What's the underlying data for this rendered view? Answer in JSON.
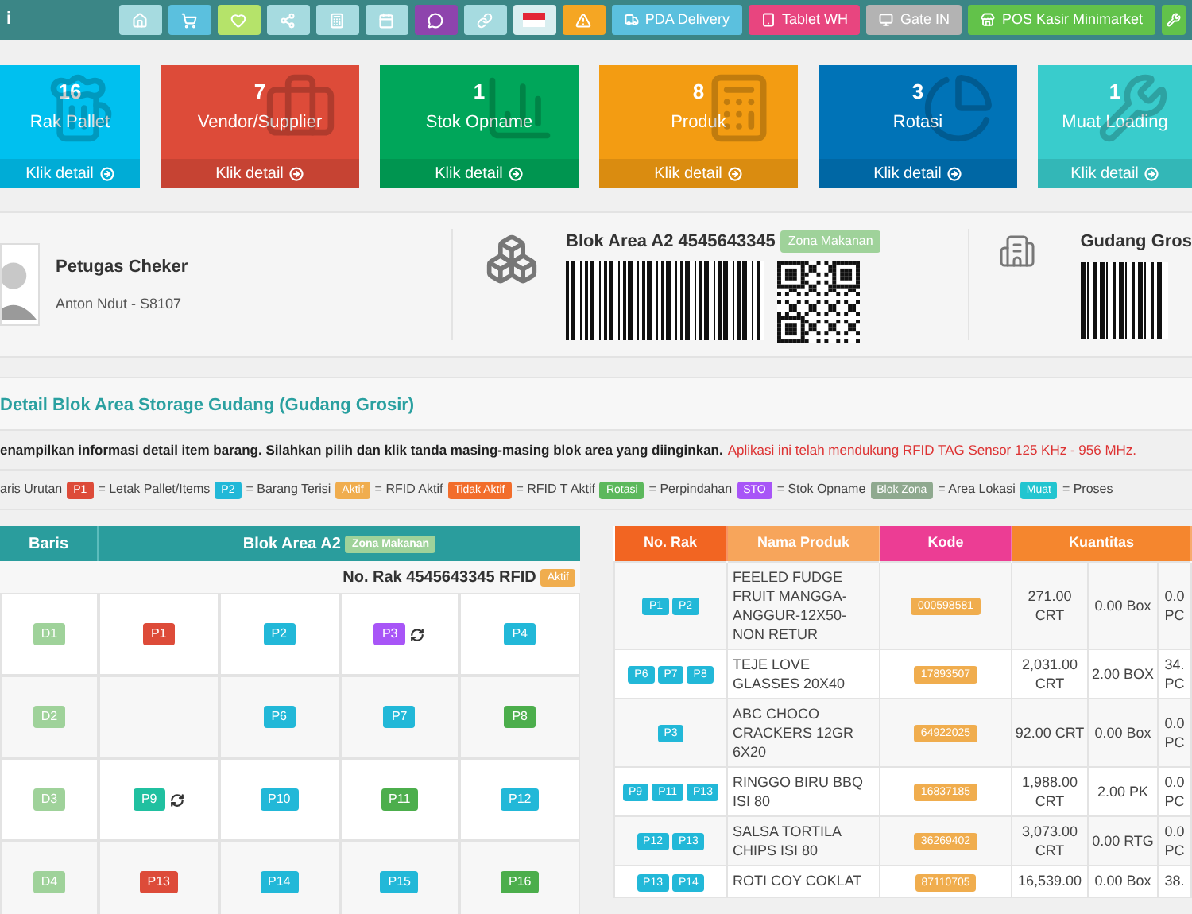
{
  "topbar": {
    "title": "i",
    "icon_buttons": [
      {
        "kind": "home",
        "color": "#a6dbe0"
      },
      {
        "kind": "cart",
        "color": "#5bc0de"
      },
      {
        "kind": "heart",
        "color": "#b5e36a"
      },
      {
        "kind": "share",
        "color": "#a6dbe0"
      },
      {
        "kind": "calculator",
        "color": "#a6dbe0"
      },
      {
        "kind": "calendar",
        "color": "#a6dbe0"
      },
      {
        "kind": "chat",
        "color": "#8e44ad"
      },
      {
        "kind": "link",
        "color": "#a6dbe0"
      },
      {
        "kind": "flag",
        "color": "#d9eef0"
      },
      {
        "kind": "warning",
        "color": "#f5a623"
      }
    ],
    "buttons": [
      {
        "label": "PDA Delivery",
        "kind": "truck",
        "color": "#5bc0de"
      },
      {
        "label": "Tablet WH",
        "kind": "tablet",
        "color": "#e8457f"
      },
      {
        "label": "Gate IN",
        "kind": "monitor",
        "color": "#b3b3b3"
      },
      {
        "label": "POS Kasir Minimarket",
        "kind": "store",
        "color": "#62c24a"
      },
      {
        "kind": "tools",
        "color": "#62c24a"
      }
    ]
  },
  "cards": [
    {
      "value": "16",
      "label": "Rak Pallet",
      "link": "Klik detail",
      "kind": "mug",
      "color": "#00c0ef"
    },
    {
      "value": "7",
      "label": "Vendor/Supplier",
      "link": "Klik detail",
      "kind": "briefcase",
      "color": "#dd4b39"
    },
    {
      "value": "1",
      "label": "Stok Opname",
      "link": "Klik detail",
      "kind": "chart",
      "color": "#00a65a"
    },
    {
      "value": "8",
      "label": "Produk",
      "link": "Klik detail",
      "kind": "calculator",
      "color": "#f39c12"
    },
    {
      "value": "3",
      "label": "Rotasi",
      "link": "Klik detail",
      "kind": "pie",
      "color": "#0073b7"
    },
    {
      "value": "1",
      "label": "Muat Loading",
      "link": "Klik detail",
      "kind": "wrench",
      "color": "#39cccc"
    }
  ],
  "info": {
    "officer": {
      "title": "Petugas Cheker",
      "subtitle": "Anton Ndut - S8107"
    },
    "block": {
      "title": "Blok Area A2 4545643345",
      "badge": "Zona Makanan"
    },
    "warehouse": {
      "title": "Gudang Gros"
    }
  },
  "section_title": "Detail Blok Area Storage Gudang (Gudang Grosir)",
  "description": {
    "text": "enampilkan informasi detail item barang. Silahkan pilih dan klik tanda masing-masing blok area yang diinginkan.",
    "notice": "Aplikasi ini telah mendukung RFID TAG Sensor 125 KHz - 956 MHz."
  },
  "legend": {
    "prefix": "aris Urutan",
    "items": [
      {
        "badge": "P1",
        "color": "#dd4b39",
        "text": "= Letak Pallet/Items"
      },
      {
        "badge": "P2",
        "color": "#22b8d8",
        "text": "= Barang Terisi"
      },
      {
        "badge": "Aktif",
        "color": "#f0ad4e",
        "text": "= RFID Aktif"
      },
      {
        "badge": "Tidak Aktif",
        "color": "#f26d2b",
        "text": "= RFID T Aktif"
      },
      {
        "badge": "Rotasi",
        "color": "#5cb85c",
        "text": "= Perpindahan"
      },
      {
        "badge": "STO",
        "color": "#a855f7",
        "text": "= Stok Opname"
      },
      {
        "badge": "Blok Zona",
        "color": "#8fa98f",
        "text": "= Area Lokasi"
      },
      {
        "badge": "Muat",
        "color": "#22c5d0",
        "text": "= Proses"
      }
    ]
  },
  "block_table": {
    "row_header": "Baris",
    "title": "Blok Area A2",
    "zone_badge": "Zona Makanan",
    "rack": "No. Rak 4545643345 RFID",
    "rack_status": "Aktif",
    "rows": [
      {
        "row": "D1",
        "cells": [
          {
            "label": "P1",
            "color": "#dd4b39",
            "rotating": false
          },
          {
            "label": "P2",
            "color": "#22b8d8",
            "rotating": false
          },
          {
            "label": "P3",
            "color": "#a855f7",
            "rotating": true
          },
          {
            "label": "P4",
            "color": "#22b8d8",
            "rotating": false
          }
        ]
      },
      {
        "row": "D2",
        "cells": [
          null,
          {
            "label": "P6",
            "color": "#22b8d8",
            "rotating": false
          },
          {
            "label": "P7",
            "color": "#22b8d8",
            "rotating": false
          },
          {
            "label": "P8",
            "color": "#4cae4c",
            "rotating": false
          }
        ]
      },
      {
        "row": "D3",
        "cells": [
          {
            "label": "P9",
            "color": "#20c0a0",
            "rotating": true
          },
          {
            "label": "P10",
            "color": "#22b8d8",
            "rotating": false
          },
          {
            "label": "P11",
            "color": "#4cae4c",
            "rotating": false
          },
          {
            "label": "P12",
            "color": "#22b8d8",
            "rotating": false
          }
        ]
      },
      {
        "row": "D4",
        "cells": [
          {
            "label": "P13",
            "color": "#dd4b39",
            "rotating": false
          },
          {
            "label": "P14",
            "color": "#22b8d8",
            "rotating": false
          },
          {
            "label": "P15",
            "color": "#22b8d8",
            "rotating": false
          },
          {
            "label": "P16",
            "color": "#4cae4c",
            "rotating": false
          }
        ]
      }
    ]
  },
  "product_table": {
    "columns": [
      {
        "label": "No. Rak",
        "color": "#f26522"
      },
      {
        "label": "Nama Produk",
        "color": "#f7a55b"
      },
      {
        "label": "Kode",
        "color": "#ec3d94"
      },
      {
        "label": "Kuantitas",
        "color": "#f5862e"
      }
    ],
    "rows": [
      {
        "racks": [
          "P1",
          "P2"
        ],
        "name": "FEELED FUDGE FRUIT MANGGA-ANGGUR-12X50-NON RETUR",
        "code": "000598581",
        "qty": [
          "271.00 CRT",
          "0.00 Box",
          "0.0 PC"
        ]
      },
      {
        "racks": [
          "P6",
          "P7",
          "P8"
        ],
        "name": "TEJE LOVE GLASSES 20X40",
        "code": "17893507",
        "qty": [
          "2,031.00 CRT",
          "2.00 BOX",
          "34. PC"
        ]
      },
      {
        "racks": [
          "P3"
        ],
        "name": "ABC CHOCO CRACKERS 12GR 6X20",
        "code": "64922025",
        "qty": [
          "92.00 CRT",
          "0.00 Box",
          "0.0 PC"
        ]
      },
      {
        "racks": [
          "P9",
          "P11",
          "P13"
        ],
        "name": "RINGGO BIRU BBQ ISI 80",
        "code": "16837185",
        "qty": [
          "1,988.00 CRT",
          "2.00 PK",
          "0.0 PC"
        ]
      },
      {
        "racks": [
          "P12",
          "P13"
        ],
        "name": "SALSA TORTILA CHIPS ISI 80",
        "code": "36269402",
        "qty": [
          "3,073.00 CRT",
          "0.00 RTG",
          "0.0 PC"
        ]
      },
      {
        "racks": [
          "P13",
          "P14"
        ],
        "name": "ROTI COY COKLAT",
        "code": "87110705",
        "qty": [
          "16,539.00",
          "0.00 Box",
          "38."
        ]
      }
    ]
  }
}
